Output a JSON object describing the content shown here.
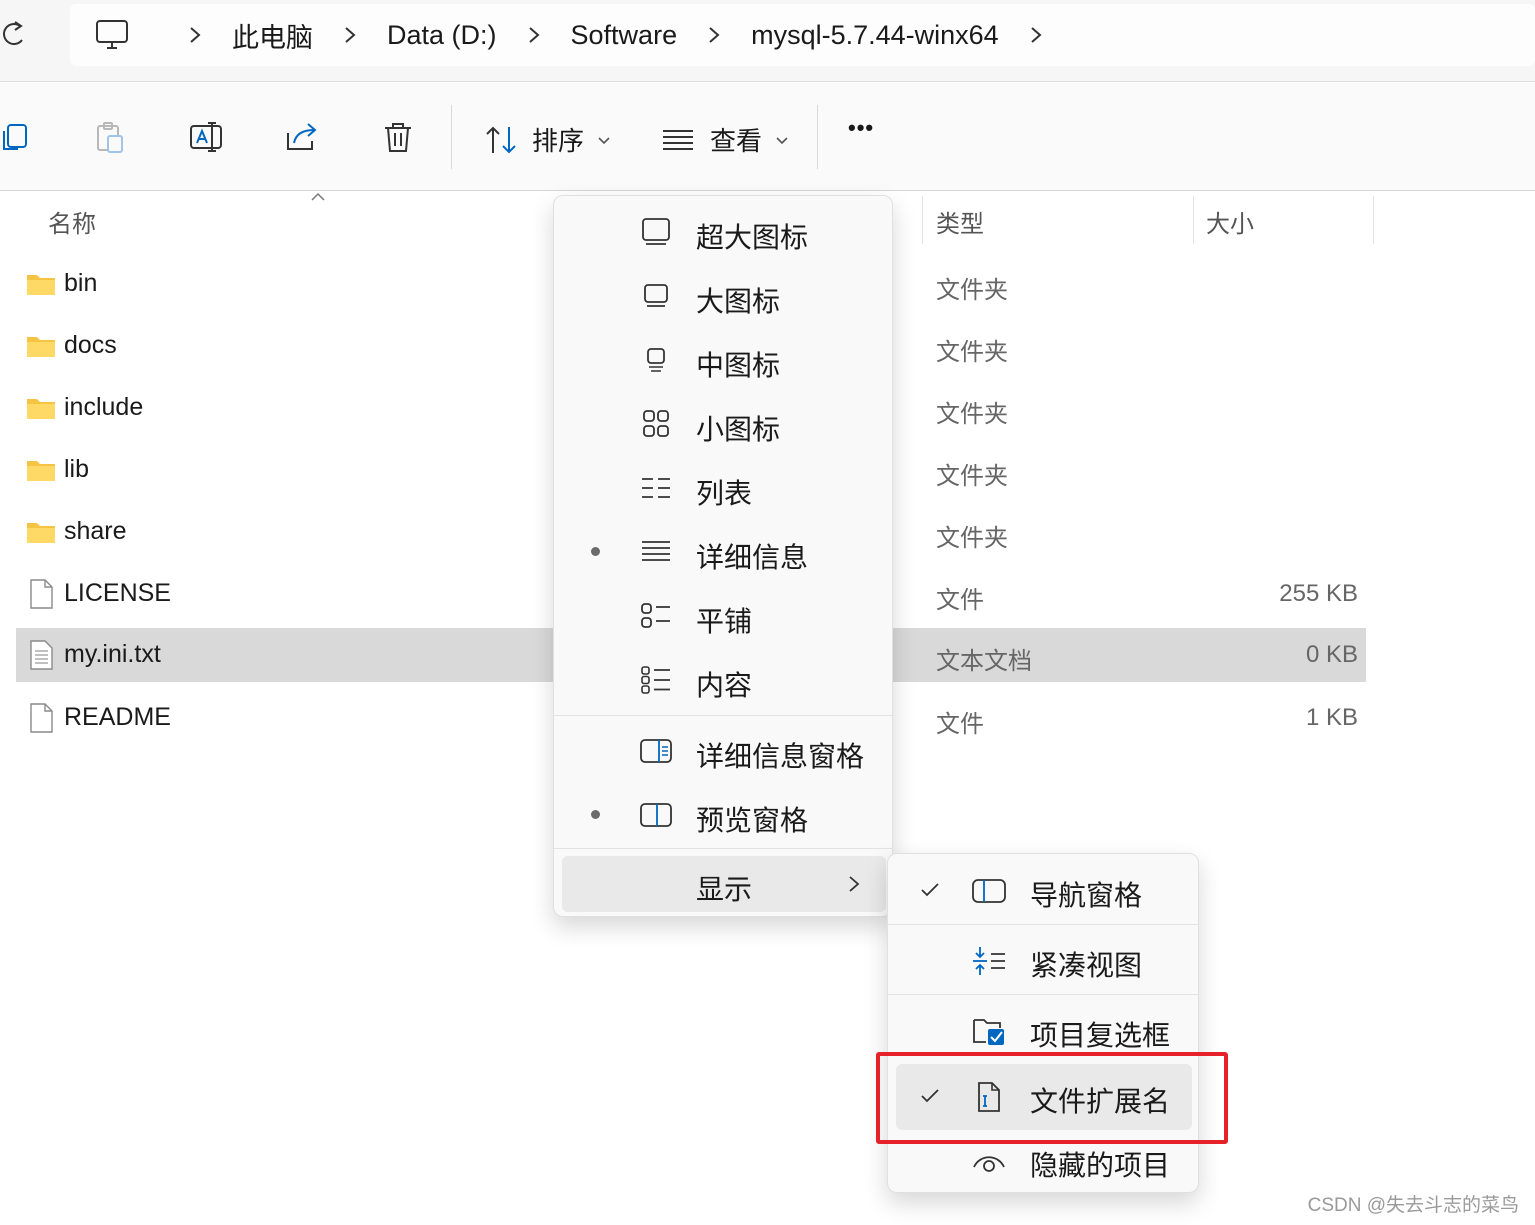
{
  "address": {
    "crumbs": [
      "此电脑",
      "Data (D:)",
      "Software",
      "mysql-5.7.44-winx64"
    ]
  },
  "toolbar": {
    "sort_label": "排序",
    "view_label": "查看",
    "more_label": "•••"
  },
  "columns": {
    "name": "名称",
    "type": "类型",
    "size": "大小"
  },
  "files": [
    {
      "name": "bin",
      "type": "文件夹",
      "size": "",
      "kind": "folder"
    },
    {
      "name": "docs",
      "type": "文件夹",
      "size": "",
      "kind": "folder"
    },
    {
      "name": "include",
      "type": "文件夹",
      "size": "",
      "kind": "folder"
    },
    {
      "name": "lib",
      "type": "文件夹",
      "size": "",
      "kind": "folder"
    },
    {
      "name": "share",
      "type": "文件夹",
      "size": "",
      "kind": "folder"
    },
    {
      "name": "LICENSE",
      "type": "文件",
      "size": "255 KB",
      "kind": "file"
    },
    {
      "name": "my.ini.txt",
      "type": "文本文档",
      "size": "0 KB",
      "kind": "text",
      "selected": true
    },
    {
      "name": "README",
      "type": "文件",
      "size": "1 KB",
      "kind": "file"
    }
  ],
  "view_menu": {
    "items": [
      {
        "label": "超大图标",
        "icon": "extra-large-icons-icon",
        "selected": false
      },
      {
        "label": "大图标",
        "icon": "large-icons-icon",
        "selected": false
      },
      {
        "label": "中图标",
        "icon": "medium-icons-icon",
        "selected": false
      },
      {
        "label": "小图标",
        "icon": "small-icons-icon",
        "selected": false
      },
      {
        "label": "列表",
        "icon": "list-icon",
        "selected": false
      },
      {
        "label": "详细信息",
        "icon": "details-icon",
        "selected": true
      },
      {
        "label": "平铺",
        "icon": "tiles-icon",
        "selected": false
      },
      {
        "label": "内容",
        "icon": "content-icon",
        "selected": false
      }
    ],
    "panes": [
      {
        "label": "详细信息窗格",
        "icon": "details-pane-icon",
        "selected": false
      },
      {
        "label": "预览窗格",
        "icon": "preview-pane-icon",
        "selected": true
      }
    ],
    "show_label": "显示"
  },
  "show_menu": {
    "items": [
      {
        "label": "导航窗格",
        "icon": "navigation-pane-icon",
        "checked": true
      },
      {
        "label": "紧凑视图",
        "icon": "compact-view-icon",
        "checked": false
      },
      {
        "label": "项目复选框",
        "icon": "item-checkbox-icon",
        "checked": false
      },
      {
        "label": "文件扩展名",
        "icon": "file-extension-icon",
        "checked": true
      },
      {
        "label": "隐藏的项目",
        "icon": "hidden-items-icon",
        "checked": false
      }
    ]
  },
  "watermark": "CSDN @失去斗志的菜鸟",
  "colors": {
    "accent": "#0067c0",
    "folder": "#f6c443",
    "highlight_box": "#e5222a",
    "selected_row": "#d9d9d9"
  }
}
